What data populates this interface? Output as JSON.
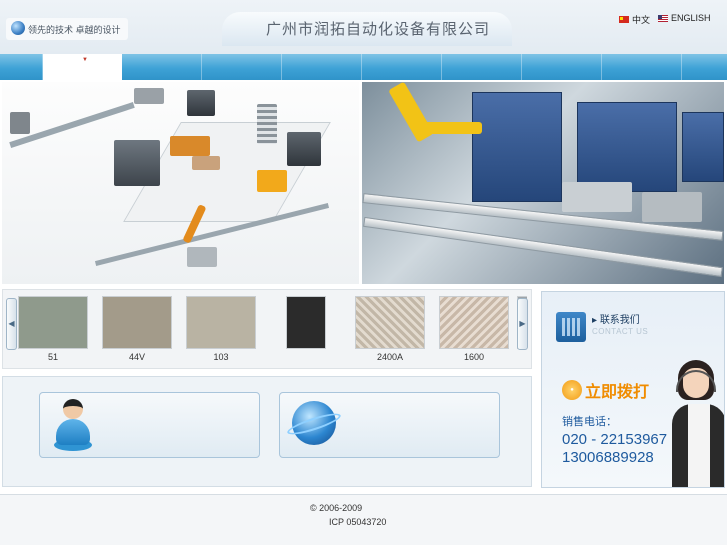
{
  "header": {
    "slogan": "领先的技术 卓越的设计",
    "site_title": "广州市润拓自动化设备有限公司",
    "lang_cn": "中文",
    "lang_en": "ENGLISH"
  },
  "nav": {
    "active_index": 0
  },
  "products": [
    {
      "label": "51",
      "color": "#8f9a8c"
    },
    {
      "label": "44V",
      "color": "#a39b8a"
    },
    {
      "label": "103",
      "color": "#b9b3a3"
    },
    {
      "label": "",
      "color": "#2b2b2b"
    },
    {
      "label": "2400A",
      "color": "#c2b7a7"
    },
    {
      "label": "1600",
      "color": "#c8b8a8"
    }
  ],
  "contact": {
    "title": "联系我们",
    "subtitle": "CONTACT US",
    "call_now": "立即拨打",
    "sales_label": "销售电话：",
    "phone1": "020 - 22153967",
    "phone2": "13006889928"
  },
  "footer": {
    "copyright": "© 2006-2009",
    "icp": "ICP 05043720"
  },
  "colors": {
    "nav_blue": "#3ea2d6",
    "title_gray": "#5a6470",
    "phone_blue": "#1e5a9e",
    "call_orange": "#f08c00"
  }
}
